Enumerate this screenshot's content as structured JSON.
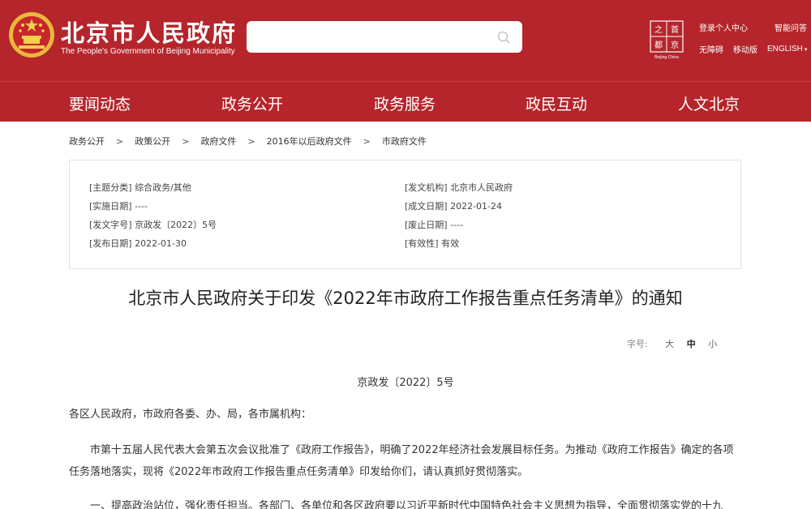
{
  "header": {
    "site_name_cn": "北京市人民政府",
    "site_name_en": "The People's Government of Beijing Municipality",
    "search": {
      "placeholder": ""
    },
    "capital_logo_caption": "Beijing·China",
    "links": {
      "login": "登录个人中心",
      "smart_qa": "智能问答",
      "accessibility": "无障碍",
      "mobile": "移动版",
      "english": "ENGLISH"
    }
  },
  "nav": {
    "items": [
      {
        "label": "要闻动态"
      },
      {
        "label": "政务公开"
      },
      {
        "label": "政务服务"
      },
      {
        "label": "政民互动"
      },
      {
        "label": "人文北京"
      }
    ]
  },
  "breadcrumb": {
    "items": [
      {
        "label": "政务公开"
      },
      {
        "label": "政策公开"
      },
      {
        "label": "政府文件"
      },
      {
        "label": "2016年以后政府文件"
      },
      {
        "label": "市政府文件"
      }
    ],
    "separator": ">"
  },
  "doc_info": {
    "topic": "[主题分类] 综合政务/其他",
    "issuer": "[发文机构] 北京市人民政府",
    "effective_date": "[实施日期] ----",
    "written_date": "[成文日期] 2022-01-24",
    "doc_no": "[发文字号] 京政发〔2022〕5号",
    "repeal_date": "[废止日期] ----",
    "publish_date": "[发布日期] 2022-01-30",
    "validity": "[有效性] 有效"
  },
  "document": {
    "title": "北京市人民政府关于印发《2022年市政府工作报告重点任务清单》的通知",
    "font_size_label": "字号:",
    "font_sizes": [
      "大",
      "中",
      "小"
    ],
    "doc_number": "京政发〔2022〕5号",
    "salutation": "各区人民政府，市政府各委、办、局，各市属机构：",
    "para1": "市第十五届人民代表大会第五次会议批准了《政府工作报告》，明确了2022年经济社会发展目标任务。为推动《政府工作报告》确定的各项任务落地落实，现将《2022年市政府工作报告重点任务清单》印发给你们，请认真抓好贯彻落实。",
    "para2": "一、提高政治站位，强化责任担当。各部门、各单位和各区政府要以习近平新时代中国特色社会主义思想为指导，全面贯彻落实党的十九"
  },
  "colors": {
    "brand_red": "#b5252b",
    "text": "#333333",
    "border": "#e3e3e3"
  }
}
